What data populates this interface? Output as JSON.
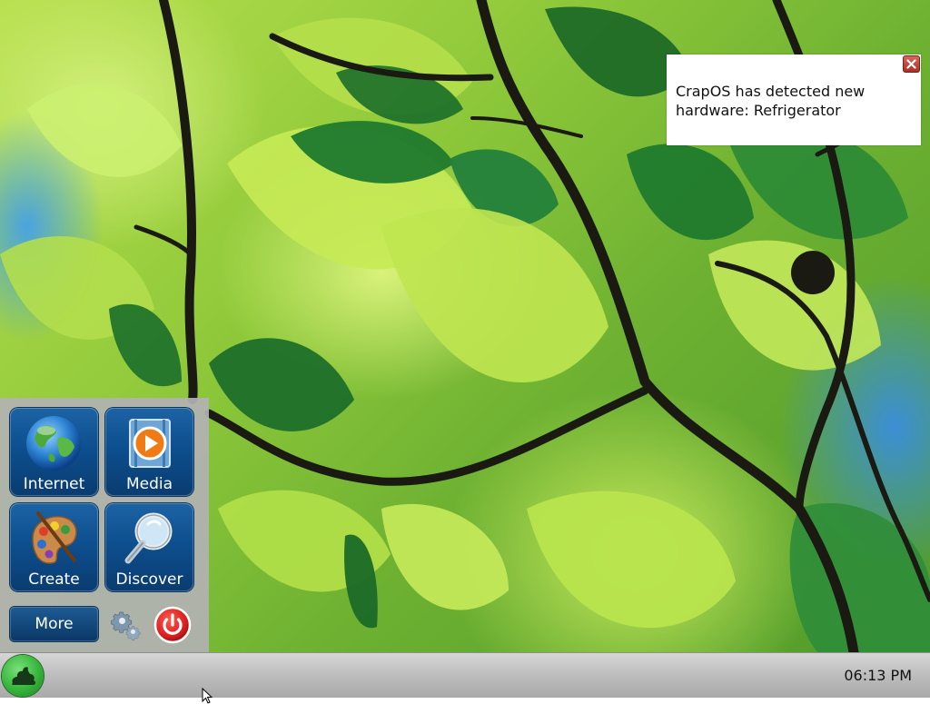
{
  "notification": {
    "message": "CrapOS has detected new hardware: Refrigerator"
  },
  "start_menu": {
    "tiles": [
      {
        "label": "Internet",
        "icon": "globe-icon"
      },
      {
        "label": "Media",
        "icon": "media-play-icon"
      },
      {
        "label": "Create",
        "icon": "paint-palette-icon"
      },
      {
        "label": "Discover",
        "icon": "magnifier-icon"
      }
    ],
    "more_label": "More",
    "settings_icon": "gear-icon",
    "power_icon": "power-icon"
  },
  "taskbar": {
    "start_icon": "poop-icon",
    "clock": "06:13 PM"
  },
  "colors": {
    "tile_blue": "#0d4f8f",
    "power_red": "#d81e1e",
    "start_green": "#35b53a"
  }
}
